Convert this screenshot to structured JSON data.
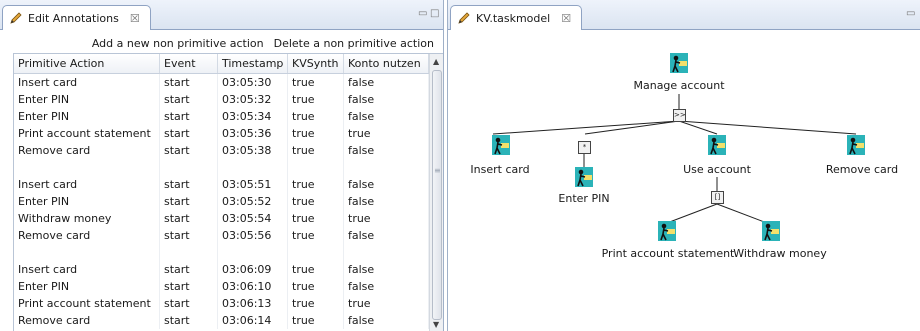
{
  "left_tab": {
    "title": "Edit Annotations",
    "close": "☒"
  },
  "right_tab": {
    "title": "KV.taskmodel",
    "close": "☒"
  },
  "toolbar": {
    "add_label": "Add a new non primitive action",
    "delete_label": "Delete a non primitive action"
  },
  "table": {
    "columns": [
      "Primitive Action",
      "Event",
      "Timestamp",
      "KVSynth",
      "Konto nutzen"
    ],
    "rows": [
      [
        "Insert card",
        "start",
        "03:05:30",
        "true",
        "false"
      ],
      [
        "Enter PIN",
        "start",
        "03:05:32",
        "true",
        "false"
      ],
      [
        "Enter PIN",
        "start",
        "03:05:34",
        "true",
        "false"
      ],
      [
        "Print account statement",
        "start",
        "03:05:36",
        "true",
        "true"
      ],
      [
        "Remove card",
        "start",
        "03:05:38",
        "true",
        "false"
      ],
      [
        "",
        "",
        "",
        "",
        ""
      ],
      [
        "Insert card",
        "start",
        "03:05:51",
        "true",
        "false"
      ],
      [
        "Enter PIN",
        "start",
        "03:05:52",
        "true",
        "false"
      ],
      [
        "Withdraw money",
        "start",
        "03:05:54",
        "true",
        "true"
      ],
      [
        "Remove card",
        "start",
        "03:05:56",
        "true",
        "false"
      ],
      [
        "",
        "",
        "",
        "",
        ""
      ],
      [
        "Insert card",
        "start",
        "03:06:09",
        "true",
        "false"
      ],
      [
        "Enter PIN",
        "start",
        "03:06:10",
        "true",
        "false"
      ],
      [
        "Print account statement",
        "start",
        "03:06:13",
        "true",
        "true"
      ],
      [
        "Remove card",
        "start",
        "03:06:14",
        "true",
        "false"
      ]
    ]
  },
  "diagram": {
    "nodes": {
      "manage_account": "Manage account",
      "insert_card": "Insert card",
      "enter_pin": "Enter PIN",
      "use_account": "Use account",
      "remove_card": "Remove card",
      "print_statement": "Print account statement",
      "withdraw_money": "Withdraw money"
    },
    "operators": {
      "enabling": ">>",
      "iteration": "*",
      "choice": "[]"
    }
  },
  "colors": {
    "tab_bar": "#dbe4f1",
    "border": "#8fa3c3",
    "icon_teal": "#2bb3b8"
  }
}
